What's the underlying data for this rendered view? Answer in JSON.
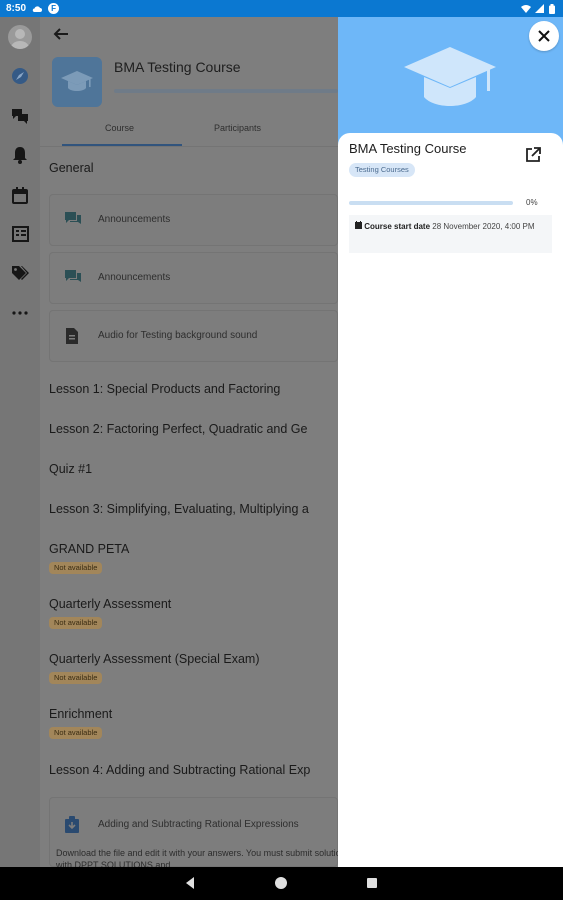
{
  "status_bar": {
    "time": "8:50"
  },
  "rail": {
    "items": [
      {
        "name": "site-home",
        "icon": "compass-icon"
      },
      {
        "name": "messages",
        "icon": "chat-bubbles-icon"
      },
      {
        "name": "notifications",
        "icon": "bell-icon"
      },
      {
        "name": "calendar",
        "icon": "calendar-icon"
      },
      {
        "name": "grades",
        "icon": "gradebook-icon"
      },
      {
        "name": "tags",
        "icon": "tags-icon"
      },
      {
        "name": "more",
        "icon": "more-horizontal-icon"
      }
    ]
  },
  "course": {
    "title": "BMA Testing Course",
    "progress_percent": 0,
    "tabs": [
      {
        "label": "Course",
        "active": true
      },
      {
        "label": "Participants",
        "active": false
      }
    ],
    "sections": {
      "general": "General",
      "general_items": [
        {
          "label": "Announcements",
          "icon": "forum-icon"
        },
        {
          "label": "Announcements",
          "icon": "forum-icon"
        },
        {
          "label": "Audio for Testing background sound",
          "icon": "file-icon"
        }
      ],
      "lesson1": "Lesson 1: Special Products and Factoring",
      "lesson2": "Lesson 2: Factoring Perfect, Quadratic and Ge",
      "quiz1": "Quiz #1",
      "lesson3": "Lesson 3: Simplifying, Evaluating, Multiplying a",
      "grand_peta": "GRAND PETA",
      "quarterly": "Quarterly Assessment",
      "quarterly_special": "Quarterly Assessment (Special Exam)",
      "enrichment": "Enrichment",
      "lesson4": "Lesson 4: Adding and Subtracting Rational Exp",
      "lesson4_item": "Adding and Subtracting Rational Expressions",
      "lesson4_desc": "Download the file and edit it with your answers. You must submit solutions with DPPT SOLUTIONS and ..."
    },
    "not_available": "Not available"
  },
  "summary_panel": {
    "title": "BMA Testing Course",
    "category": "Testing Courses",
    "progress_label": "0%",
    "progress_fraction": 0,
    "start_label": "Course start date",
    "start_value": "28 November 2020, 4:00 PM"
  },
  "colors": {
    "status_bar": "#0b78d1",
    "hero": "#6eb7f8",
    "badge": "#a2865a"
  }
}
